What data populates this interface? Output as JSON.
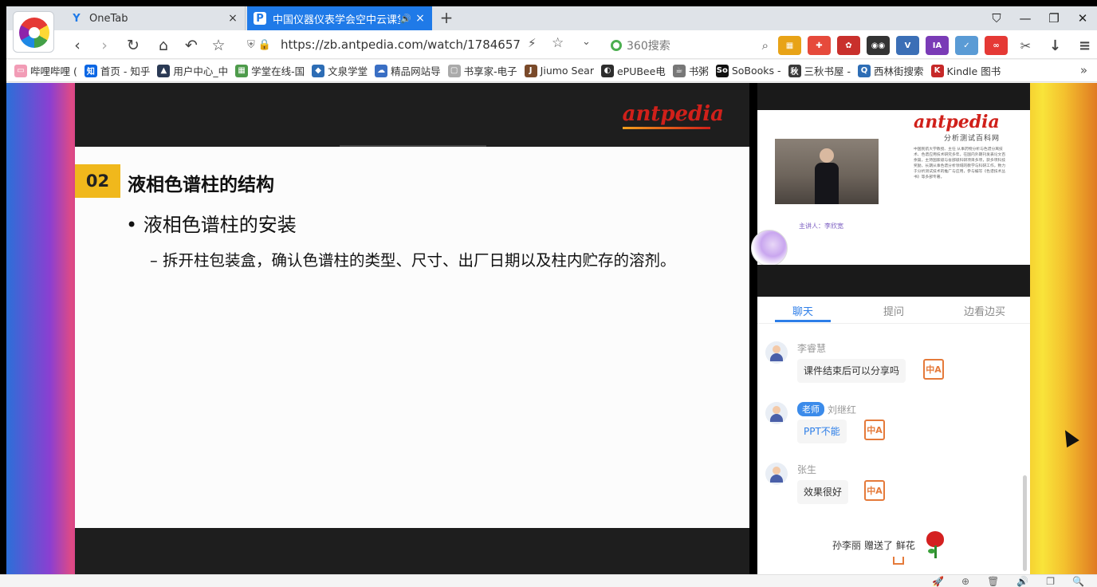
{
  "tabs": [
    {
      "title": "OneTab",
      "favicon": "onetab-icon",
      "close": "×"
    },
    {
      "title": "中国仪器仪表学会空中云课堂",
      "favicon": "antpedia-p-icon",
      "close": "×",
      "audio": "🔊"
    }
  ],
  "tab_new": "+",
  "window_controls": {
    "shirt": "⛉",
    "minimize": "—",
    "restore": "❐",
    "close": "✕"
  },
  "nav": {
    "back": "‹",
    "forward": "›",
    "reload": "↻",
    "home": "⌂",
    "undo": "↶",
    "bookmark": "☆"
  },
  "address": {
    "url": "https://zb.antpedia.com/watch/1784657",
    "shield": "⛨",
    "lock": "🔒",
    "bolt": "⚡",
    "star": "☆",
    "dropdown": "⌄"
  },
  "search": {
    "placeholder": "360搜索",
    "icon": "⌕"
  },
  "extensions": [
    {
      "name": "apps-icon",
      "label": "▦",
      "color": "#e8a317"
    },
    {
      "name": "gamepad-icon",
      "label": "✚",
      "color": "#e64a3b"
    },
    {
      "name": "ublock-icon",
      "label": "✿",
      "color": "#c9302c"
    },
    {
      "name": "glasses-icon",
      "label": "◉◉",
      "color": "#333333"
    },
    {
      "name": "vue-icon",
      "label": "V",
      "color": "#3b6fb6"
    },
    {
      "name": "ia-new-icon",
      "label": "IA",
      "color": "#7a3bb6"
    },
    {
      "name": "shield-color-icon",
      "label": "✓",
      "color": "#5a9bd5"
    },
    {
      "name": "infinity-icon",
      "label": "∞",
      "color": "#e53935"
    },
    {
      "name": "scissors-icon",
      "label": "✂",
      "color": "#555555"
    },
    {
      "name": "download-icon",
      "label": "↓",
      "color": "#444444"
    },
    {
      "name": "menu-icon",
      "label": "≡",
      "color": "#444444"
    }
  ],
  "bookmarks": [
    {
      "label": "哔哩哔哩 (",
      "icon": "tv",
      "color": "#f29cb6"
    },
    {
      "label": "首页 - 知乎",
      "icon": "知",
      "color": "#0a66e4"
    },
    {
      "label": "用户中心_中",
      "icon": "▲",
      "color": "#2b3a55"
    },
    {
      "label": "学堂在线-国",
      "icon": "▦",
      "color": "#4e9b4b"
    },
    {
      "label": "文泉学堂",
      "icon": "◆",
      "color": "#2d6db5"
    },
    {
      "label": "精品网站导",
      "icon": "☁",
      "color": "#3a6fc4"
    },
    {
      "label": "书享家-电子",
      "icon": "▢",
      "color": "#aaaaaa"
    },
    {
      "label": "Jiumo Sear",
      "icon": "J",
      "color": "#7a4a2a"
    },
    {
      "label": "ePUBee电",
      "icon": "◐",
      "color": "#2d2d2d"
    },
    {
      "label": "书粥",
      "icon": "☕",
      "color": "#777777"
    },
    {
      "label": "SoBooks -",
      "icon": "So",
      "color": "#111111"
    },
    {
      "label": "三秋书屋 -",
      "icon": "秋",
      "color": "#3a3a3a"
    },
    {
      "label": "西林街搜索",
      "icon": "Q",
      "color": "#2d6db5"
    },
    {
      "label": "Kindle 图书",
      "icon": "K",
      "color": "#c62828"
    }
  ],
  "bookmarks_more": "»",
  "slide": {
    "logo": "antpedia",
    "section_number": "02",
    "heading": "液相色谱柱的结构",
    "bullet": "• 液相色谱柱的安装",
    "subpoint": "– 拆开柱包装盒，确认色谱柱的类型、尺寸、出厂日期以及柱内贮存的溶剂。"
  },
  "camera": {
    "logo": "antpedia",
    "sublogo": "分析测试百科网",
    "caption": "主讲人：李欣宽",
    "text": "中国民航大学教授、主任 从事药物分析与色谱分离技术、色谱应用技术研究多年，在国内外期刊发表论文百余篇，主持国家级与省部级科研项目多项，获多项科技奖励，长期从事色谱分析领域的教学与科研工作，致力于分析测试技术的推广与应用，参与编写《色谱技术丛书》等多部专著。"
  },
  "chat": {
    "tabs": [
      {
        "label": "聊天",
        "active": true
      },
      {
        "label": "提问",
        "active": false
      },
      {
        "label": "边看边买",
        "active": false
      }
    ],
    "messages": [
      {
        "name": "李睿慧",
        "role": "",
        "text": "课件结束后可以分享吗",
        "link": false
      },
      {
        "name": "刘继红",
        "role": "老师",
        "text": "PPT不能",
        "link": true
      },
      {
        "name": "张生",
        "role": "",
        "text": "效果很好",
        "link": false
      }
    ],
    "translate_icon": "中A",
    "gift": {
      "user": "孙李丽",
      "text": "赠送了 鲜花"
    }
  },
  "status_icons": [
    "🚀",
    "⊕",
    "🗑",
    "🔊",
    "❐",
    "🔍"
  ]
}
